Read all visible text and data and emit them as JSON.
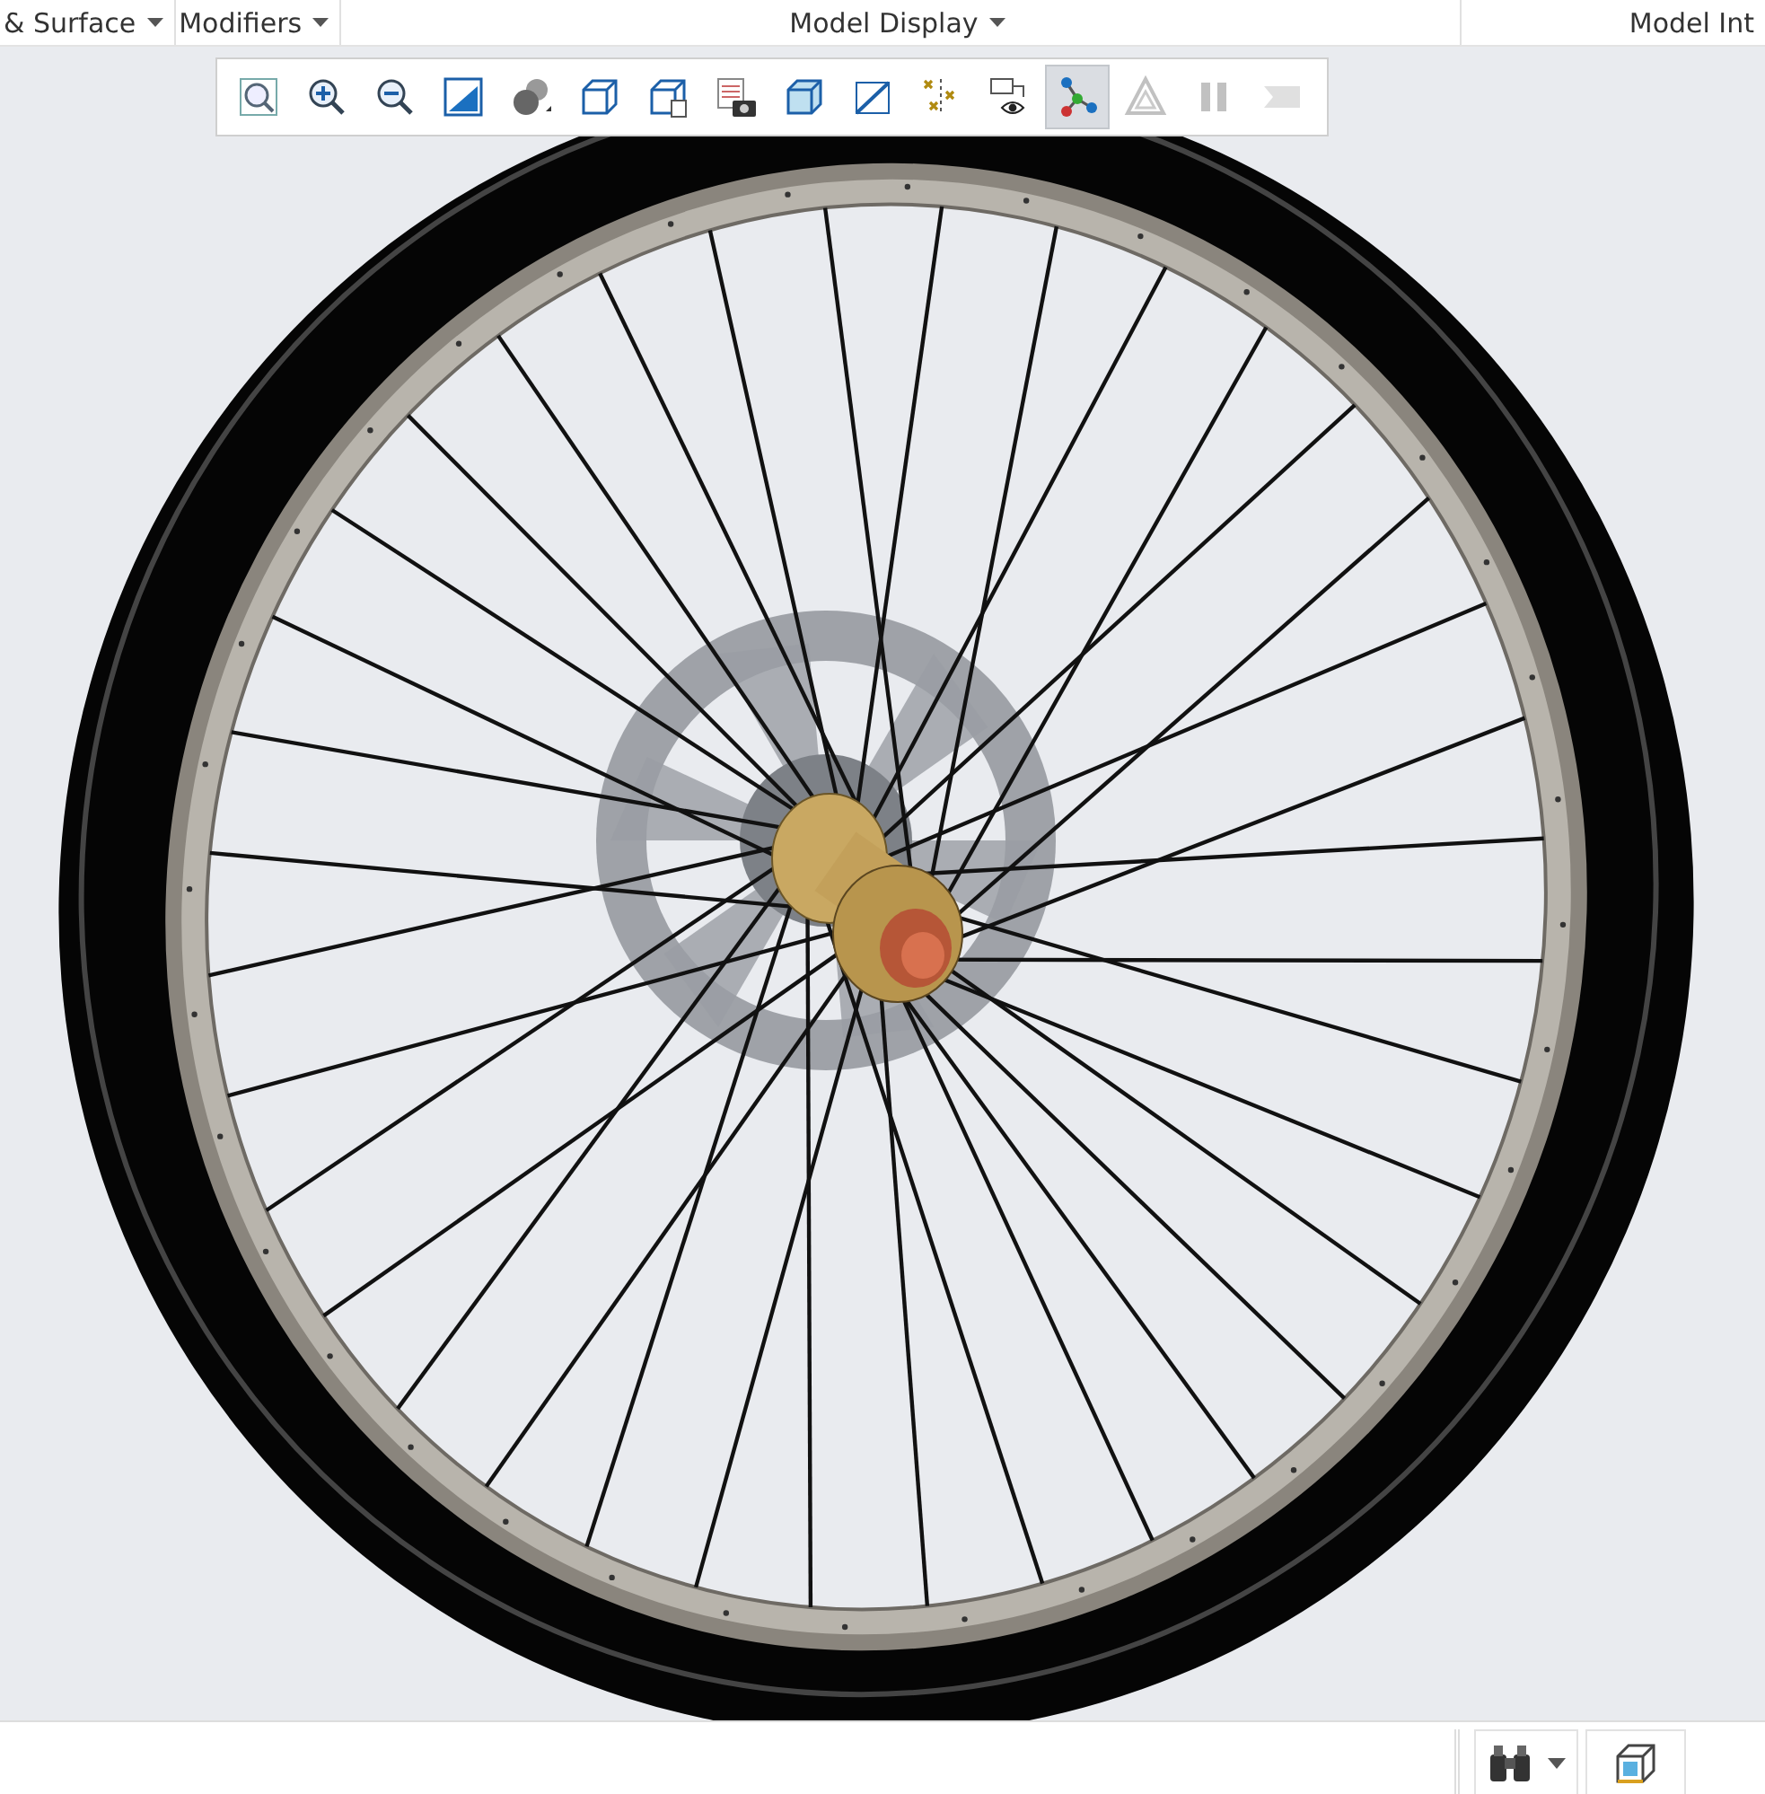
{
  "ribbon": {
    "groups": [
      {
        "label": "& Surface",
        "dropdown": true
      },
      {
        "label": "Modifiers",
        "dropdown": true
      },
      {
        "label": "Model Display",
        "dropdown": true
      },
      {
        "label": "Model Int",
        "dropdown": false
      }
    ]
  },
  "view_toolbar": {
    "tools": [
      {
        "kind": "zoom-fit",
        "selected": false,
        "disabled": false
      },
      {
        "kind": "zoom-in",
        "selected": false,
        "disabled": false
      },
      {
        "kind": "zoom-out",
        "selected": false,
        "disabled": false
      },
      {
        "kind": "repaint",
        "selected": false,
        "disabled": false
      },
      {
        "kind": "spheres",
        "selected": false,
        "disabled": false
      },
      {
        "kind": "cube",
        "selected": false,
        "disabled": false
      },
      {
        "kind": "cube-doc",
        "selected": false,
        "disabled": false
      },
      {
        "kind": "camera",
        "selected": false,
        "disabled": false
      },
      {
        "kind": "glass-cube",
        "selected": false,
        "disabled": false
      },
      {
        "kind": "section",
        "selected": false,
        "disabled": false
      },
      {
        "kind": "points",
        "selected": false,
        "disabled": false
      },
      {
        "kind": "eye",
        "selected": false,
        "disabled": false
      },
      {
        "kind": "nodes",
        "selected": true,
        "disabled": false
      },
      {
        "kind": "triangle",
        "selected": false,
        "disabled": true
      },
      {
        "kind": "pause",
        "selected": false,
        "disabled": true
      },
      {
        "kind": "tag",
        "selected": false,
        "disabled": true
      }
    ]
  },
  "status_bar": {
    "tools": [
      {
        "kind": "binoculars",
        "dropdown": true
      },
      {
        "kind": "box"
      }
    ]
  }
}
